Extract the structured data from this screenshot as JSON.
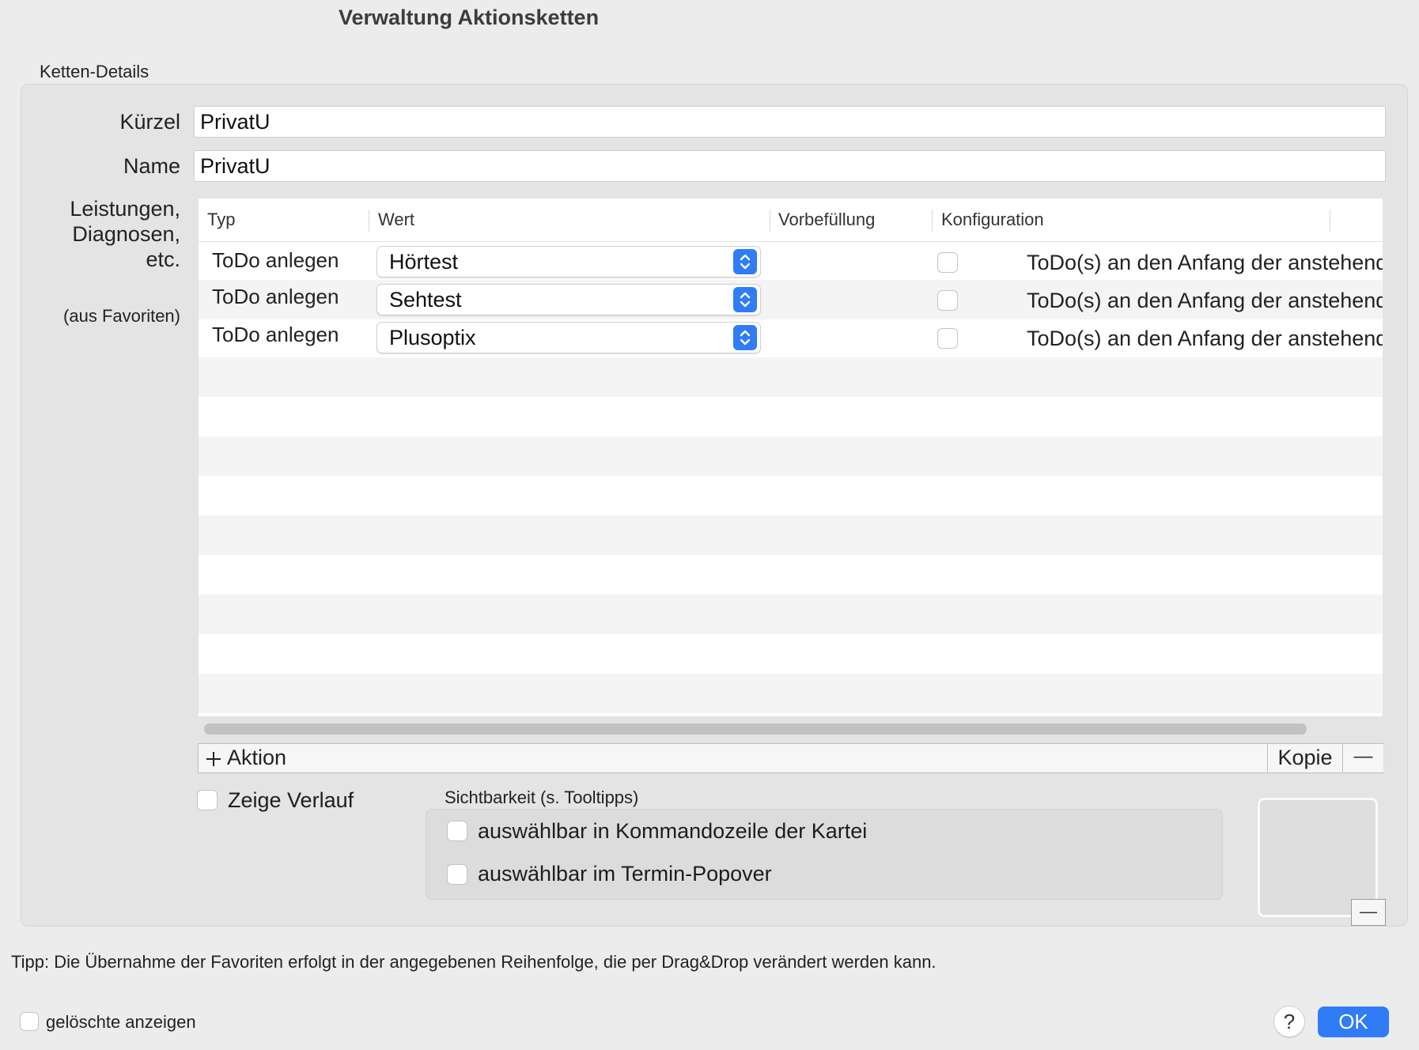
{
  "window": {
    "title": "Verwaltung Aktionsketten"
  },
  "details": {
    "group_label": "Ketten-Details",
    "kuerzel_label": "Kürzel",
    "kuerzel_value": "PrivatU",
    "name_label": "Name",
    "name_value": "PrivatU",
    "leistungen_label_1": "Leistungen,",
    "leistungen_label_2": "Diagnosen,",
    "leistungen_label_3": "etc.",
    "favoriten_hint": "(aus Favoriten)"
  },
  "table": {
    "columns": {
      "typ": "Typ",
      "wert": "Wert",
      "vorbefuellung": "Vorbefüllung",
      "konfiguration": "Konfiguration"
    },
    "rows": [
      {
        "typ": "ToDo anlegen",
        "wert": "Hörtest",
        "vorbefuellung": "",
        "konfiguration": "ToDo(s) an den Anfang der anstehenden To",
        "checked": false
      },
      {
        "typ": "ToDo anlegen",
        "wert": "Sehtest",
        "vorbefuellung": "",
        "konfiguration": "ToDo(s) an den Anfang der anstehenden To",
        "checked": false
      },
      {
        "typ": "ToDo anlegen",
        "wert": "Plusoptix",
        "vorbefuellung": "",
        "konfiguration": "ToDo(s) an den Anfang der anstehenden To",
        "checked": false
      }
    ]
  },
  "toolbar": {
    "add_label": "Aktion",
    "copy_label": "Kopie",
    "remove_label": "—"
  },
  "options": {
    "zeige_verlauf": "Zeige Verlauf",
    "sichtbarkeit_label": "Sichtbarkeit (s. Tooltipps)",
    "kommandozeile": "auswählbar in Kommandozeile der Kartei",
    "termin_popover": "auswählbar im Termin-Popover",
    "image_remove": "—"
  },
  "footer": {
    "tip": "Tipp: Die Übernahme der Favoriten erfolgt in der angegebenen Reihenfolge, die per Drag&Drop verändert werden kann.",
    "geloeschte": "gelöschte anzeigen",
    "help": "?",
    "ok": "OK"
  },
  "colors": {
    "accent": "#2f7cf6",
    "window_bg": "#ececec",
    "group_bg": "#e4e4e4"
  }
}
